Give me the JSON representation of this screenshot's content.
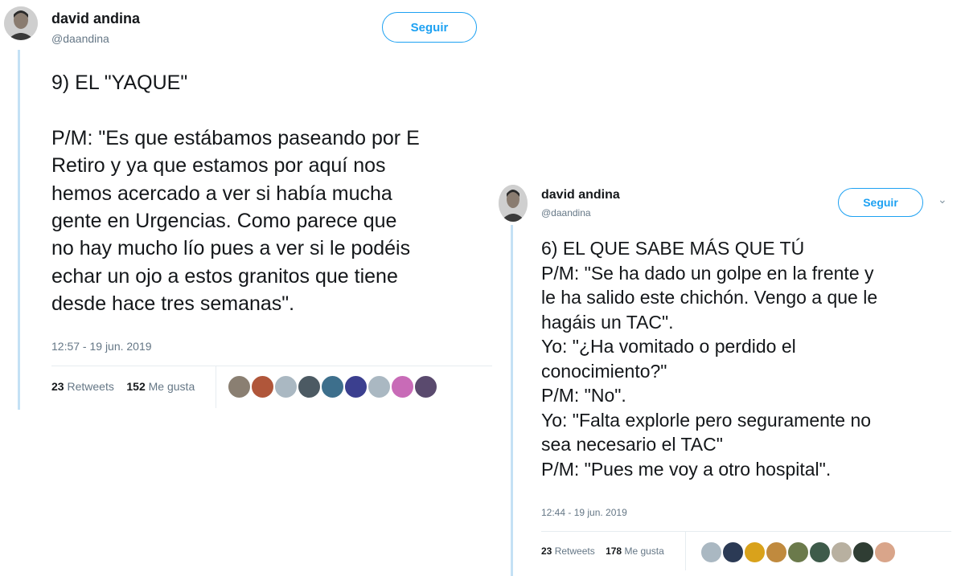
{
  "tweet1": {
    "name": "david andina",
    "handle": "@daandina",
    "follow_label": "Seguir",
    "lines": [
      "9) EL \"YAQUE\"",
      "",
      "P/M: \"Es que estábamos paseando por E",
      "Retiro y ya que estamos por aquí nos",
      "hemos acercado a ver si había mucha",
      "gente en Urgencias. Como parece que",
      "no hay mucho lío pues a ver si le podéis",
      "echar un ojo a estos granitos que tiene",
      "desde hace tres semanas\"."
    ],
    "timestamp": "12:57 - 19 jun. 2019",
    "retweets_count": "23",
    "retweets_label": "Retweets",
    "likes_count": "152",
    "likes_label": "Me gusta",
    "liker_colors": [
      "#8a7f72",
      "#b0563a",
      "#aab8c2",
      "#4c5a63",
      "#3d6f8c",
      "#3b3f8f",
      "#aab8c2",
      "#c86bb7",
      "#5a4a6e"
    ]
  },
  "tweet2": {
    "name": "david andina",
    "handle": "@daandina",
    "follow_label": "Seguir",
    "lines": [
      "6) EL QUE SABE MÁS QUE TÚ",
      "P/M: \"Se ha dado un golpe en la frente y",
      "le ha salido este chichón. Vengo a que le",
      "hagáis un TAC\".",
      "Yo: \"¿Ha vomitado o perdido el",
      "conocimiento?\"",
      "P/M: \"No\".",
      "Yo: \"Falta explorle pero seguramente no",
      "sea necesario el TAC\"",
      "P/M: \"Pues me voy a otro hospital\"."
    ],
    "timestamp": "12:44 - 19 jun. 2019",
    "retweets_count": "23",
    "retweets_label": "Retweets",
    "likes_count": "178",
    "likes_label": "Me gusta",
    "liker_colors": [
      "#aab8c2",
      "#2b3a55",
      "#d9a21b",
      "#c08a3e",
      "#6b7a4b",
      "#3e5b4a",
      "#b8b0a0",
      "#2f3d33",
      "#d9a58a"
    ]
  }
}
